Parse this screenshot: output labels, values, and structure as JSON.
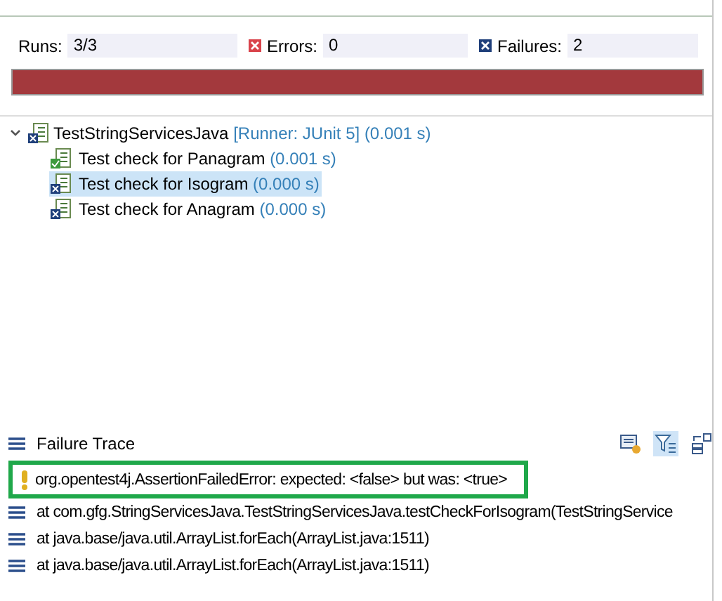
{
  "counters": [
    {
      "kind": "runs",
      "label": "Runs:",
      "value": "3/3"
    },
    {
      "kind": "errors",
      "label": "Errors:",
      "value": "0"
    },
    {
      "kind": "failures",
      "label": "Failures:",
      "value": "2"
    }
  ],
  "progress": {
    "level": 1
  },
  "tree": [
    {
      "label": "TestStringServicesJava",
      "detail": "[Runner: JUnit 5] (0.001 s)",
      "expanded": true,
      "selected": false,
      "children": [
        {
          "kind": "pass",
          "label": "Test check for Panagram",
          "detail": "(0.001 s)",
          "selected": false
        },
        {
          "kind": "fail",
          "label": "Test check for Isogram",
          "detail": "(0.000 s)",
          "selected": true
        },
        {
          "kind": "fail",
          "label": "Test check for Anagram",
          "detail": "(0.000 s)",
          "selected": false
        }
      ]
    }
  ],
  "failure_trace": {
    "title": "Failure Trace",
    "lines": [
      {
        "kind": "error",
        "text": "org.opentest4j.AssertionFailedError: expected: <false> but was: <true>",
        "highlighted": true
      },
      {
        "kind": "frame",
        "text": "at com.gfg.StringServicesJava.TestStringServicesJava.testCheckForIsogram(TestStringService",
        "highlighted": false
      },
      {
        "kind": "frame",
        "text": "at java.base/java.util.ArrayList.forEach(ArrayList.java:1511)",
        "highlighted": false
      },
      {
        "kind": "frame",
        "text": "at java.base/java.util.ArrayList.forEach(ArrayList.java:1511)",
        "highlighted": false
      }
    ]
  }
}
